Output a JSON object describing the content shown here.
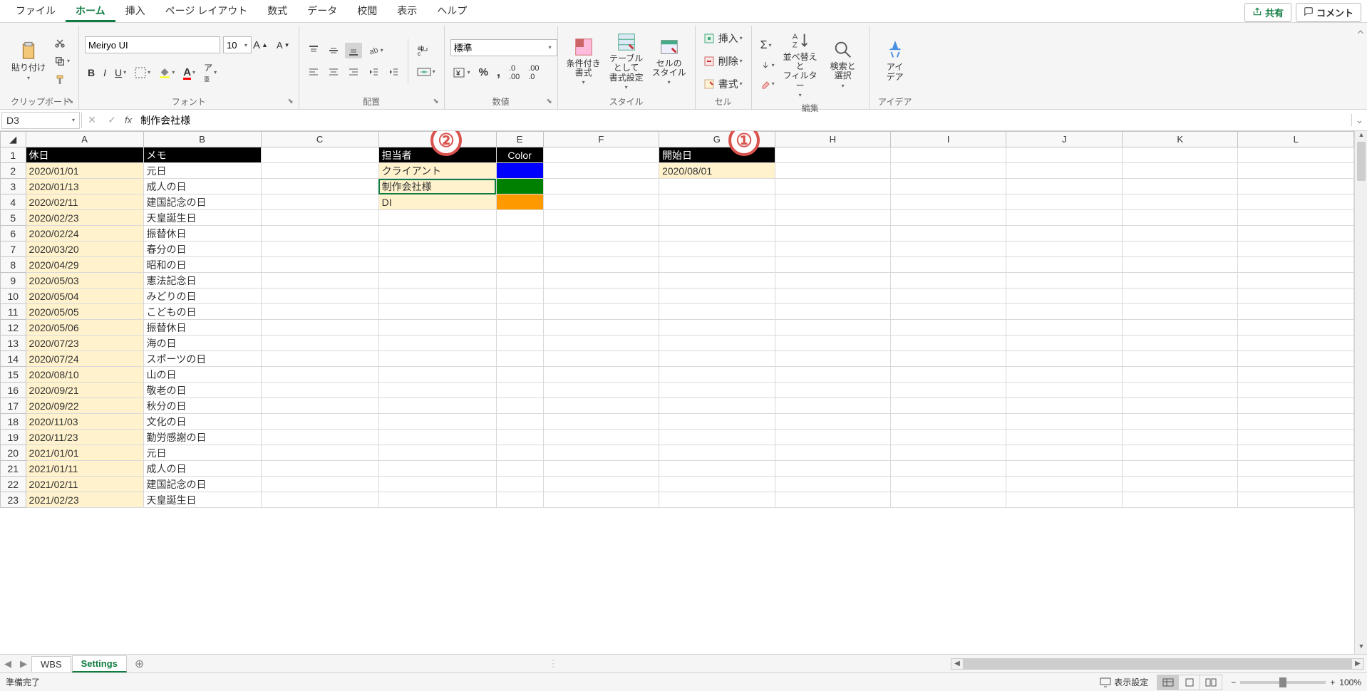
{
  "menu": {
    "file": "ファイル",
    "home": "ホーム",
    "insert": "挿入",
    "page_layout": "ページ レイアウト",
    "formulas": "数式",
    "data": "データ",
    "review": "校閲",
    "view": "表示",
    "help": "ヘルプ",
    "share": "共有",
    "comments": "コメント"
  },
  "ribbon": {
    "clipboard": {
      "paste": "貼り付け",
      "label": "クリップボード"
    },
    "font": {
      "name": "Meiryo UI",
      "size": "10",
      "label": "フォント"
    },
    "align": {
      "label": "配置"
    },
    "number": {
      "format": "標準",
      "label": "数値"
    },
    "styles": {
      "cond": "条件付き\n書式",
      "table": "テーブルとして\n書式設定",
      "cell": "セルの\nスタイル",
      "label": "スタイル"
    },
    "cells": {
      "insert": "挿入",
      "delete": "削除",
      "format": "書式",
      "label": "セル"
    },
    "editing": {
      "sort": "並べ替えと\nフィルター",
      "find": "検索と\n選択",
      "label": "編集"
    },
    "ideas": {
      "ideas": "アイ\nデア",
      "label": "アイデア"
    }
  },
  "namebox": "D3",
  "formula": "制作会社様",
  "cols": [
    "A",
    "B",
    "C",
    "D",
    "E",
    "F",
    "G",
    "H",
    "I",
    "J",
    "K",
    "L"
  ],
  "headers": {
    "A1": "休日",
    "B1": "メモ",
    "D1": "担当者",
    "E1": "Color",
    "G1": "開始日"
  },
  "holidays": [
    {
      "d": "2020/01/01",
      "m": "元日"
    },
    {
      "d": "2020/01/13",
      "m": "成人の日"
    },
    {
      "d": "2020/02/11",
      "m": "建国記念の日"
    },
    {
      "d": "2020/02/23",
      "m": "天皇誕生日"
    },
    {
      "d": "2020/02/24",
      "m": "振替休日"
    },
    {
      "d": "2020/03/20",
      "m": "春分の日"
    },
    {
      "d": "2020/04/29",
      "m": "昭和の日"
    },
    {
      "d": "2020/05/03",
      "m": "憲法記念日"
    },
    {
      "d": "2020/05/04",
      "m": "みどりの日"
    },
    {
      "d": "2020/05/05",
      "m": "こどもの日"
    },
    {
      "d": "2020/05/06",
      "m": "振替休日"
    },
    {
      "d": "2020/07/23",
      "m": "海の日"
    },
    {
      "d": "2020/07/24",
      "m": "スポーツの日"
    },
    {
      "d": "2020/08/10",
      "m": "山の日"
    },
    {
      "d": "2020/09/21",
      "m": "敬老の日"
    },
    {
      "d": "2020/09/22",
      "m": "秋分の日"
    },
    {
      "d": "2020/11/03",
      "m": "文化の日"
    },
    {
      "d": "2020/11/23",
      "m": "勤労感謝の日"
    },
    {
      "d": "2021/01/01",
      "m": "元日"
    },
    {
      "d": "2021/01/11",
      "m": "成人の日"
    },
    {
      "d": "2021/02/11",
      "m": "建国記念の日"
    },
    {
      "d": "2021/02/23",
      "m": "天皇誕生日"
    }
  ],
  "assignees": [
    {
      "n": "クライアント",
      "c": "blue"
    },
    {
      "n": "制作会社様",
      "c": "green"
    },
    {
      "n": "DI",
      "c": "orange"
    }
  ],
  "start_date": "2020/08/01",
  "callouts": {
    "one": "①",
    "two": "②"
  },
  "sheets": {
    "wbs": "WBS",
    "settings": "Settings"
  },
  "status": {
    "ready": "準備完了",
    "display": "表示設定",
    "zoom": "100%"
  }
}
